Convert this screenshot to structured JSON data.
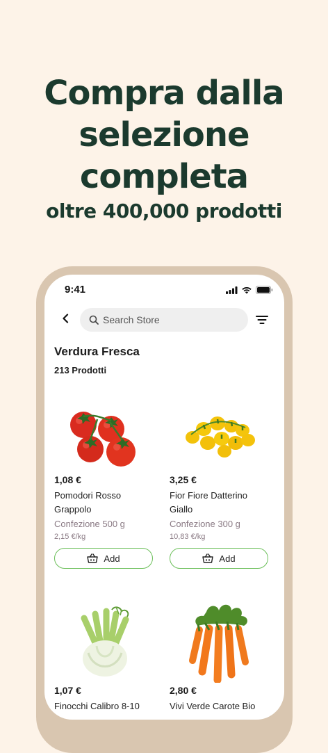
{
  "hero": {
    "line1": "Compra dalla",
    "line2": "selezione",
    "line3": "completa",
    "subtitle": "oltre 400,000 prodotti"
  },
  "status_bar": {
    "time": "9:41"
  },
  "header": {
    "search_placeholder": "Search Store"
  },
  "category": {
    "title": "Verdura Fresca",
    "count": "213 Prodotti"
  },
  "products": [
    {
      "price": "1,08 €",
      "name_line1": "Pomodori Rosso",
      "name_line2": "Grappolo",
      "pack": "Confezione 500 g",
      "unit_price": "2,15 €/kg",
      "add_label": "Add",
      "image": "tomatoes-red"
    },
    {
      "price": "3,25 €",
      "name_line1": "Fior Fiore Datterino",
      "name_line2": "Giallo",
      "pack": "Confezione 300 g",
      "unit_price": "10,83 €/kg",
      "add_label": "Add",
      "image": "tomatoes-yellow"
    },
    {
      "price": "1,07 €",
      "name_line1": "Finocchi Calibro 8-10",
      "image": "fennel"
    },
    {
      "price": "2,80 €",
      "name_line1": "Vivi Verde Carote Bio",
      "image": "carrots"
    }
  ],
  "colors": {
    "background": "#fdf3e8",
    "heading": "#1b3a2e",
    "add_border": "#6bbf59",
    "phone_frame": "#d9c6b0"
  }
}
